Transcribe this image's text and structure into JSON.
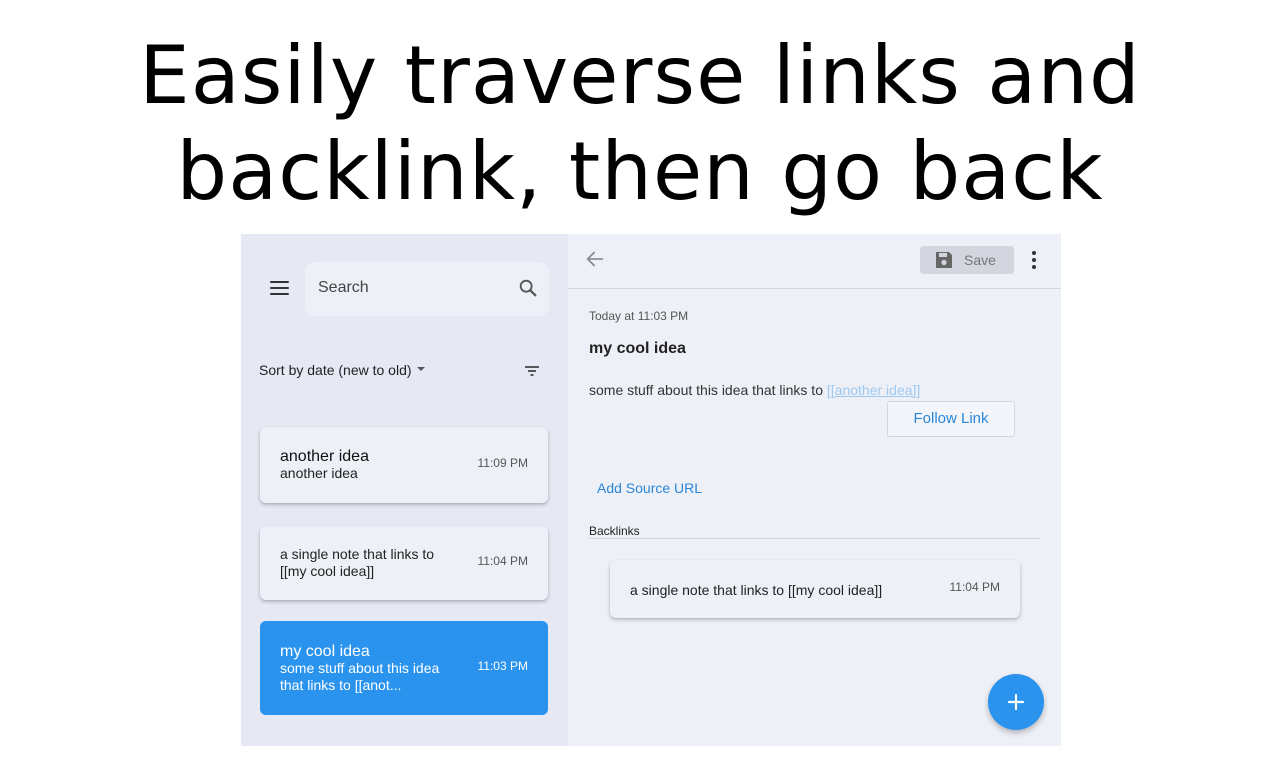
{
  "headline": {
    "line1": "Easily traverse links and",
    "line2": "backlink, then go back"
  },
  "sidebar": {
    "search_placeholder": "Search",
    "sort_label": "Sort by date (new to old)",
    "notes": [
      {
        "title": "another idea",
        "preview": "another idea",
        "time": "11:09 PM",
        "selected": false
      },
      {
        "title": "",
        "preview": "a single note that links to [[my cool idea]]",
        "time": "11:04 PM",
        "selected": false
      },
      {
        "title": "my cool idea",
        "preview": "some stuff about this idea that links to [[anot...",
        "time": "11:03 PM",
        "selected": true
      }
    ]
  },
  "editor": {
    "save_label": "Save",
    "timestamp": "Today at 11:03 PM",
    "title": "my cool idea",
    "body_text": "some stuff about this idea that links to",
    "body_link": "[[another idea]]",
    "follow_link_label": "Follow Link",
    "add_source_label": "Add Source URL",
    "backlinks_heading": "Backlinks",
    "backlinks": [
      {
        "text": "a single note that links to [[my cool idea]]",
        "time": "11:04 PM"
      }
    ]
  },
  "icons": {
    "menu": "menu-icon",
    "search": "search-icon",
    "filter": "filter-icon",
    "back": "arrow-left-icon",
    "save": "floppy-disk-icon",
    "more": "more-vertical-icon",
    "add": "plus-icon"
  },
  "colors": {
    "accent": "#2a93ee",
    "link_text": "#2a87d8",
    "panel_background": "#eef0f7",
    "sidebar_background": "#e6e9f4"
  }
}
